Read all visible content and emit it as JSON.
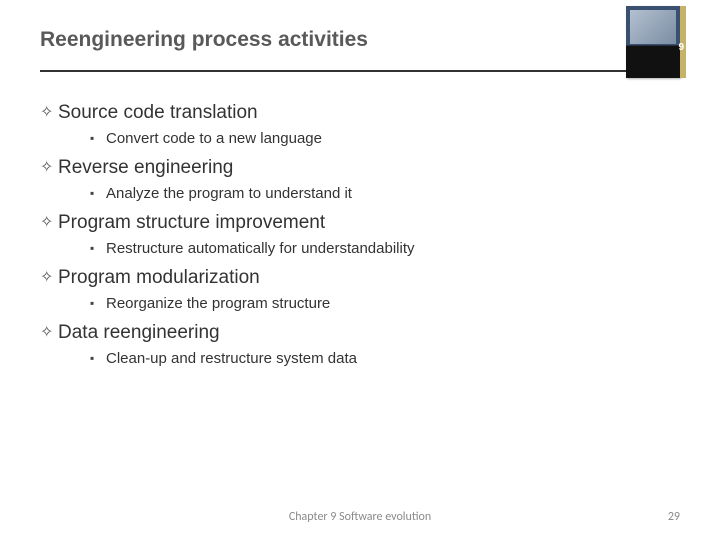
{
  "header": {
    "title": "Reengineering process activities",
    "book_number": "9"
  },
  "bullets": [
    {
      "title": "Source code translation",
      "sub": "Convert code to a new language"
    },
    {
      "title": "Reverse engineering",
      "sub": "Analyze the program to understand it"
    },
    {
      "title": "Program structure improvement",
      "sub": "Restructure automatically for understandability"
    },
    {
      "title": "Program modularization",
      "sub": "Reorganize the program structure"
    },
    {
      "title": "Data reengineering",
      "sub": "Clean-up and restructure system data"
    }
  ],
  "footer": {
    "chapter": "Chapter 9 Software evolution",
    "page": "29"
  }
}
